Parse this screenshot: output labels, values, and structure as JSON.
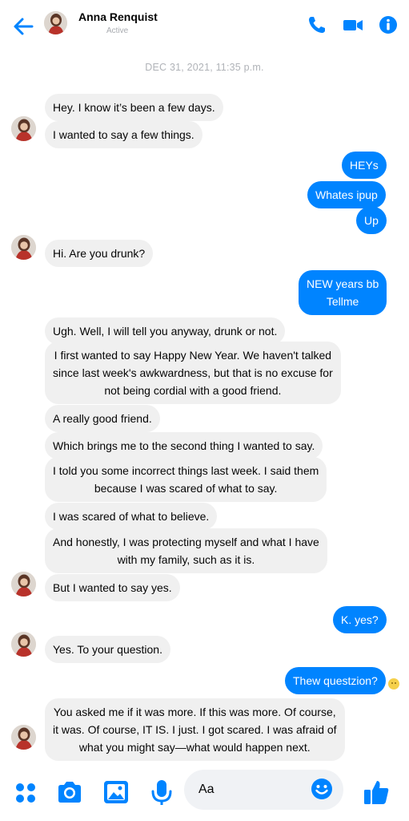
{
  "header": {
    "name": "Anna Renquist",
    "status": "Active"
  },
  "timestamp": "DEC 31, 2021, 11:35 p.m.",
  "messages": [
    {
      "text": "Hey. I know it’s been a few days."
    },
    {
      "text": "I wanted to say a few things."
    },
    {
      "text": "HEYs"
    },
    {
      "text": "Whates ipup"
    },
    {
      "text": "Up"
    },
    {
      "text": "Hi. Are you drunk?"
    },
    {
      "text": "NEW years bb\nTellme"
    },
    {
      "text": "Ugh. Well, I will tell you anyway, drunk or not."
    },
    {
      "text": "I first wanted to say Happy New Year. We haven't talked\nsince last week's awkwardness, but that is no excuse for\nnot being cordial with a good friend."
    },
    {
      "text": "A really good friend."
    },
    {
      "text": "Which brings me to the second thing I wanted to say."
    },
    {
      "text": "I told you some incorrect things last week. I said them\nbecause I was scared of what to say."
    },
    {
      "text": "I was scared of what to believe."
    },
    {
      "text": "And honestly, I was protecting myself and what I have\nwith my family, such as it is."
    },
    {
      "text": "But I wanted to say yes."
    },
    {
      "text": "K. yes?"
    },
    {
      "text": "Yes. To your question."
    },
    {
      "text": "Thew questzion?"
    },
    {
      "text": "You asked me if it was more. If this was more. Of course,\nit was. Of course, IT IS. I just. I got scared. I was afraid of\nwhat you might say—what would happen next."
    }
  ],
  "composer": {
    "placeholder": "Aa"
  },
  "icons": [
    "back-arrow-icon",
    "phone-icon",
    "video-camera-icon",
    "info-icon",
    "apps-grid-icon",
    "camera-icon",
    "image-icon",
    "microphone-icon",
    "emoji-icon",
    "thumbs-up-icon"
  ],
  "colors": {
    "accent": "#0084ff",
    "incoming_bubble": "#f0f0f0",
    "muted_text": "#b0b3b8"
  }
}
